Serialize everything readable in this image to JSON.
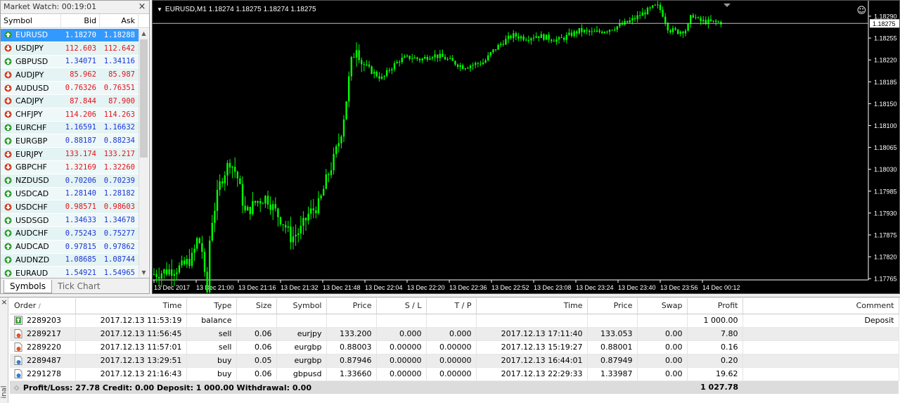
{
  "market_watch": {
    "title": "Market Watch: 00:19:01",
    "columns": [
      "Symbol",
      "Bid",
      "Ask"
    ],
    "rows": [
      {
        "symbol": "EURUSD",
        "bid": "1.18270",
        "ask": "1.18288",
        "dir": "up",
        "selected": true
      },
      {
        "symbol": "USDJPY",
        "bid": "112.603",
        "ask": "112.642",
        "dir": "down"
      },
      {
        "symbol": "GBPUSD",
        "bid": "1.34071",
        "ask": "1.34116",
        "dir": "up"
      },
      {
        "symbol": "AUDJPY",
        "bid": "85.962",
        "ask": "85.987",
        "dir": "down"
      },
      {
        "symbol": "AUDUSD",
        "bid": "0.76326",
        "ask": "0.76351",
        "dir": "down"
      },
      {
        "symbol": "CADJPY",
        "bid": "87.844",
        "ask": "87.900",
        "dir": "down"
      },
      {
        "symbol": "CHFJPY",
        "bid": "114.206",
        "ask": "114.263",
        "dir": "down"
      },
      {
        "symbol": "EURCHF",
        "bid": "1.16591",
        "ask": "1.16632",
        "dir": "up"
      },
      {
        "symbol": "EURGBP",
        "bid": "0.88187",
        "ask": "0.88234",
        "dir": "up"
      },
      {
        "symbol": "EURJPY",
        "bid": "133.174",
        "ask": "133.217",
        "dir": "down"
      },
      {
        "symbol": "GBPCHF",
        "bid": "1.32169",
        "ask": "1.32260",
        "dir": "down"
      },
      {
        "symbol": "NZDUSD",
        "bid": "0.70206",
        "ask": "0.70239",
        "dir": "up"
      },
      {
        "symbol": "USDCAD",
        "bid": "1.28140",
        "ask": "1.28182",
        "dir": "up"
      },
      {
        "symbol": "USDCHF",
        "bid": "0.98571",
        "ask": "0.98603",
        "dir": "down"
      },
      {
        "symbol": "USDSGD",
        "bid": "1.34633",
        "ask": "1.34678",
        "dir": "up"
      },
      {
        "symbol": "AUDCHF",
        "bid": "0.75243",
        "ask": "0.75277",
        "dir": "up"
      },
      {
        "symbol": "AUDCAD",
        "bid": "0.97815",
        "ask": "0.97862",
        "dir": "up"
      },
      {
        "symbol": "AUDNZD",
        "bid": "1.08685",
        "ask": "1.08744",
        "dir": "up"
      },
      {
        "symbol": "EURAUD",
        "bid": "1.54921",
        "ask": "1.54965",
        "dir": "up"
      }
    ],
    "tabs": [
      "Symbols",
      "Tick Chart"
    ]
  },
  "chart": {
    "title": "EURUSD,M1  1.18274 1.18275 1.18274 1.18275",
    "current_price_label": "1.18275",
    "colors": {
      "background": "#000000",
      "candle": "#00ff00",
      "axis_text": "#ffffff",
      "price_line": "#c0c0c0"
    }
  },
  "chart_data": {
    "type": "candlestick",
    "y_ticks": [
      "1.18290",
      "1.18255",
      "1.18220",
      "1.18185",
      "1.18150",
      "1.18100",
      "1.18065",
      "1.18030",
      "1.17985",
      "1.17930",
      "1.17875",
      "1.17820",
      "1.17765",
      "1.17710",
      "1.17655"
    ],
    "ylim": [
      1.17655,
      1.1829
    ],
    "x_ticks": [
      "13 Dec 2017",
      "13 Dec 21:00",
      "13 Dec 21:16",
      "13 Dec 21:32",
      "13 Dec 21:48",
      "13 Dec 22:04",
      "13 Dec 22:20",
      "13 Dec 22:36",
      "13 Dec 22:52",
      "13 Dec 23:08",
      "13 Dec 23:24",
      "13 Dec 23:40",
      "13 Dec 23:56",
      "14 Dec 00:12"
    ],
    "current_price": 1.18275
  },
  "terminal": {
    "label": "inal",
    "columns": [
      "Order",
      "Time",
      "Type",
      "Size",
      "Symbol",
      "Price",
      "S / L",
      "T / P",
      "Time",
      "Price",
      "Swap",
      "Profit",
      "Comment"
    ],
    "rows": [
      {
        "order": "2289203",
        "time": "2017.12.13 11:53:19",
        "type": "balance",
        "size": "",
        "symbol": "",
        "price": "",
        "sl": "",
        "tp": "",
        "close_time": "",
        "close_price": "",
        "swap": "",
        "profit": "1 000.00",
        "comment": "Deposit",
        "icon": "balance"
      },
      {
        "order": "2289217",
        "time": "2017.12.13 11:56:45",
        "type": "sell",
        "size": "0.06",
        "symbol": "eurjpy",
        "price": "133.200",
        "sl": "0.000",
        "tp": "0.000",
        "close_time": "2017.12.13 17:11:40",
        "close_price": "133.053",
        "swap": "0.00",
        "profit": "7.80",
        "comment": "",
        "icon": "sell"
      },
      {
        "order": "2289220",
        "time": "2017.12.13 11:57:01",
        "type": "sell",
        "size": "0.06",
        "symbol": "eurgbp",
        "price": "0.88003",
        "sl": "0.00000",
        "tp": "0.00000",
        "close_time": "2017.12.13 15:19:27",
        "close_price": "0.88001",
        "swap": "0.00",
        "profit": "0.16",
        "comment": "",
        "icon": "sell"
      },
      {
        "order": "2289487",
        "time": "2017.12.13 13:29:51",
        "type": "buy",
        "size": "0.05",
        "symbol": "eurgbp",
        "price": "0.87946",
        "sl": "0.00000",
        "tp": "0.00000",
        "close_time": "2017.12.13 16:44:01",
        "close_price": "0.87949",
        "swap": "0.00",
        "profit": "0.20",
        "comment": "",
        "icon": "buy"
      },
      {
        "order": "2291278",
        "time": "2017.12.13 21:16:43",
        "type": "buy",
        "size": "0.06",
        "symbol": "gbpusd",
        "price": "1.33660",
        "sl": "0.00000",
        "tp": "0.00000",
        "close_time": "2017.12.13 22:29:33",
        "close_price": "1.33987",
        "swap": "0.00",
        "profit": "19.62",
        "comment": "",
        "icon": "buy"
      }
    ],
    "summary": {
      "text": "Profit/Loss: 27.78  Credit: 0.00  Deposit: 1 000.00  Withdrawal: 0.00",
      "total": "1 027.78"
    }
  }
}
